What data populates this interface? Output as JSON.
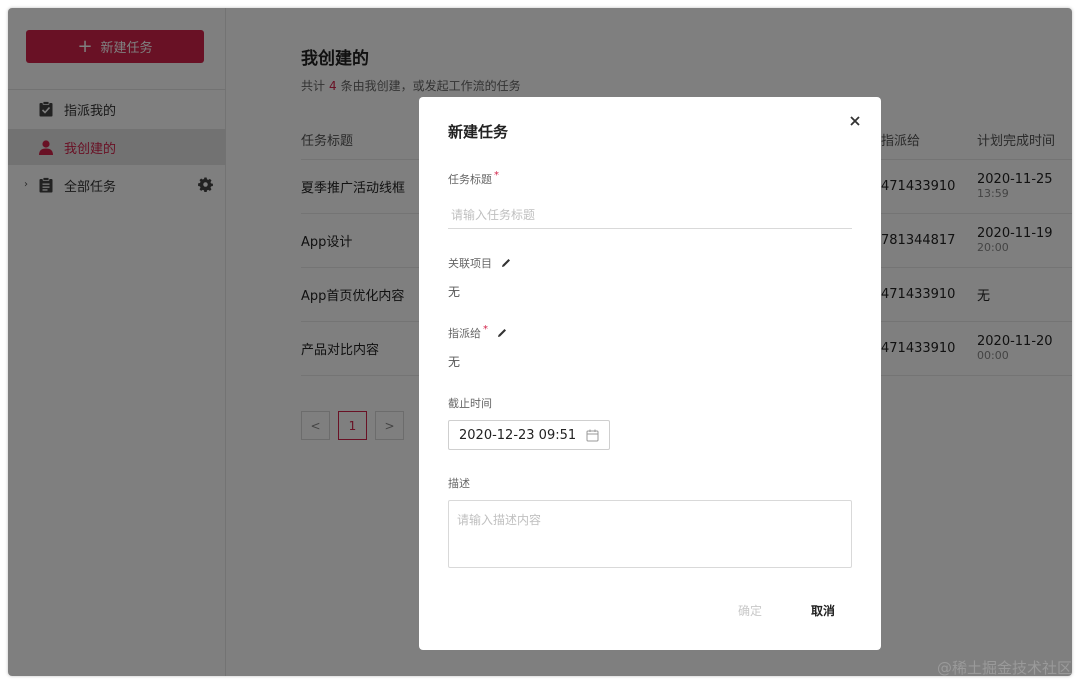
{
  "sidebar": {
    "new_task_label": "新建任务",
    "items": [
      {
        "label": "指派我的",
        "icon": "clipboard-check-icon"
      },
      {
        "label": "我创建的",
        "icon": "user-icon"
      },
      {
        "label": "全部任务",
        "icon": "clipboard-list-icon"
      }
    ]
  },
  "main": {
    "title": "我创建的",
    "subtitle_prefix": "共计",
    "count": "4",
    "subtitle_suffix": "条由我创建，或发起工作流的任务",
    "columns": [
      "任务标题",
      "指派给",
      "计划完成时间"
    ],
    "rows": [
      {
        "title": "夏季推广活动线框",
        "assignee": "471433910",
        "date": "2020-11-25",
        "time": "13:59"
      },
      {
        "title": "App设计",
        "assignee": "781344817",
        "date": "2020-11-19",
        "time": "20:00"
      },
      {
        "title": "App首页优化内容",
        "assignee": "471433910",
        "date": "无",
        "time": ""
      },
      {
        "title": "产品对比内容",
        "assignee": "471433910",
        "date": "2020-11-20",
        "time": "00:00"
      }
    ],
    "pagination": {
      "prev": "<",
      "current": "1",
      "next": ">"
    }
  },
  "modal": {
    "title": "新建任务",
    "close": "×",
    "task_title_label": "任务标题",
    "task_title_placeholder": "请输入任务标题",
    "project_label": "关联项目",
    "project_value": "无",
    "assignee_label": "指派给",
    "assignee_value": "无",
    "deadline_label": "截止时间",
    "deadline_value": "2020-12-23 09:51",
    "desc_label": "描述",
    "desc_placeholder": "请输入描述内容",
    "ok_label": "确定",
    "cancel_label": "取消",
    "required_mark": "*"
  },
  "watermark": "@稀土掘金技术社区",
  "colors": {
    "accent": "#d2234a",
    "overlay": "rgba(0,0,0,0.5)"
  }
}
